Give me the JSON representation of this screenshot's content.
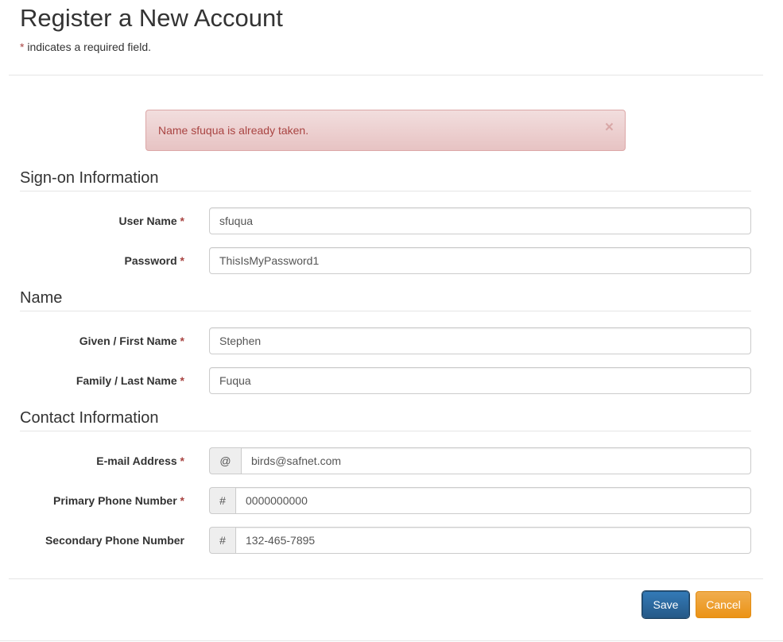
{
  "page": {
    "title": "Register a New Account",
    "required_star": "*",
    "required_note": " indicates a required field."
  },
  "alert": {
    "message": "Name sfuqua is already taken.",
    "close": "×"
  },
  "sections": {
    "signon": "Sign-on Information",
    "name": "Name",
    "contact": "Contact Information"
  },
  "fields": {
    "username": {
      "label": "User Name",
      "value": "sfuqua",
      "required": "*"
    },
    "password": {
      "label": "Password",
      "value": "ThisIsMyPassword1",
      "required": "*"
    },
    "first_name": {
      "label": "Given / First Name",
      "value": "Stephen",
      "required": "*"
    },
    "last_name": {
      "label": "Family / Last Name",
      "value": "Fuqua",
      "required": "*"
    },
    "email": {
      "label": "E-mail Address",
      "addon": "@",
      "value": "birds@safnet.com",
      "required": "*"
    },
    "primary_phone": {
      "label": "Primary Phone Number",
      "addon": "#",
      "value": "0000000000",
      "required": "*"
    },
    "secondary_phone": {
      "label": "Secondary Phone Number",
      "addon": "#",
      "value": "132-465-7895"
    }
  },
  "buttons": {
    "save": "Save",
    "cancel": "Cancel"
  },
  "colors": {
    "required": "#a94442",
    "alert_bg": "#f2dede",
    "save": "#337ab7",
    "cancel": "#f0ad4e"
  }
}
